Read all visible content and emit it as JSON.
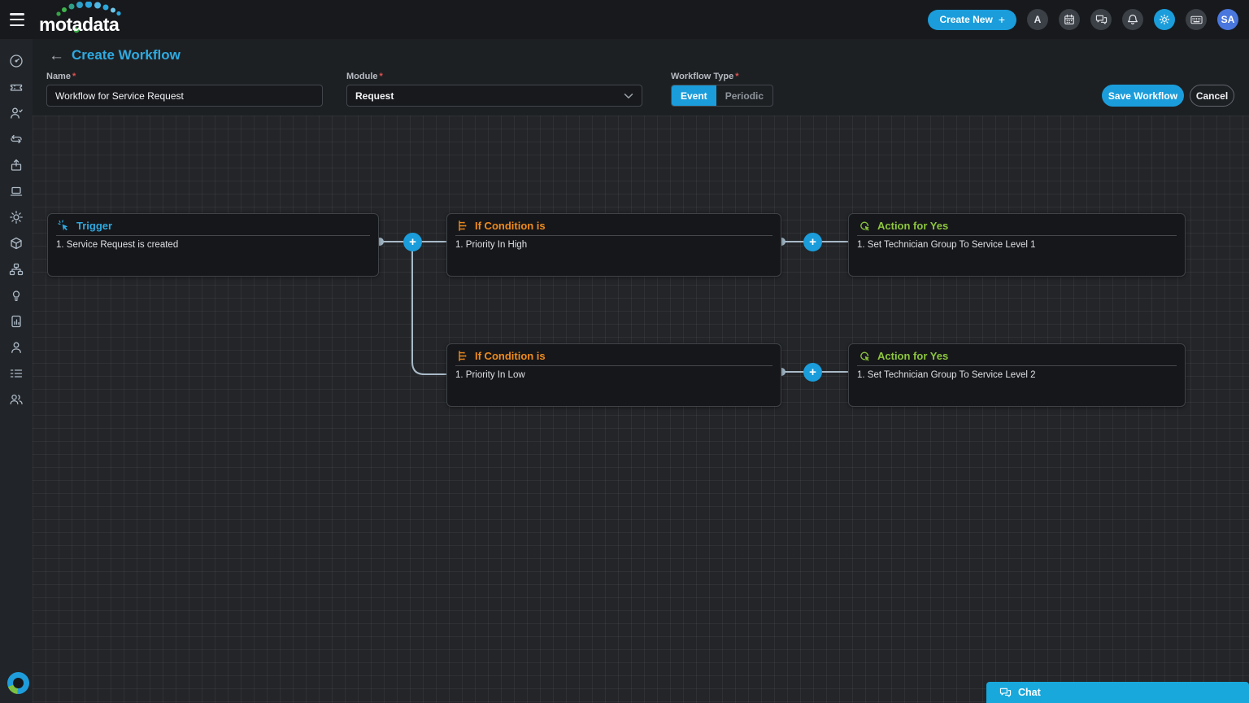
{
  "topbar": {
    "brand": "motadata",
    "create_new_label": "Create New",
    "announcement_initial": "A",
    "user_initials": "SA",
    "icon_names": [
      "hamburger-icon",
      "calendar-icon",
      "chat-bubbles-icon",
      "bell-icon",
      "gear-icon",
      "keyboard-icon"
    ]
  },
  "header": {
    "title": "Create Workflow",
    "back_arrow": "←",
    "name_label": "Name",
    "module_label": "Module",
    "workflow_type_label": "Workflow Type",
    "required_marker": "*",
    "name_value": "Workflow for Service Request",
    "module_value": "Request",
    "workflow_types": [
      "Event",
      "Periodic"
    ],
    "selected_type": "Event",
    "save_label": "Save Workflow",
    "cancel_label": "Cancel",
    "plus_glyph": "+"
  },
  "sidebar": {
    "icon_names": [
      "gauge-icon",
      "ticket-icon",
      "user-check-icon",
      "repeat-icon",
      "release-icon",
      "laptop-icon",
      "gear-icon",
      "package-icon",
      "sitemap-icon",
      "bulb-icon",
      "report-icon",
      "technician-icon",
      "task-list-icon",
      "contacts-icon"
    ]
  },
  "canvas": {
    "nodes": [
      {
        "id": "trigger",
        "type": "trigger",
        "title": "Trigger",
        "items": [
          "1. Service Request is created"
        ]
      },
      {
        "id": "condition-1",
        "type": "condition",
        "title": "If Condition is",
        "items": [
          "1. Priority In High"
        ]
      },
      {
        "id": "action-1",
        "type": "action",
        "title": "Action for Yes",
        "items": [
          "1. Set Technician Group To Service Level 1"
        ]
      },
      {
        "id": "condition-2",
        "type": "condition",
        "title": "If Condition is",
        "items": [
          "1. Priority In Low"
        ]
      },
      {
        "id": "action-2",
        "type": "action",
        "title": "Action for Yes",
        "items": [
          "1. Set Technician Group To Service Level 2"
        ]
      }
    ]
  },
  "chat": {
    "label": "Chat"
  },
  "colors": {
    "accent_blue": "#1b9ddb",
    "title_blue": "#2eaae1",
    "condition_orange": "#ef8b1d",
    "action_green": "#8dc63f",
    "canvas_bg": "#232528",
    "node_bg": "#16171a",
    "topbar_bg": "#17191c",
    "chat_bar_blue": "#18a8dc",
    "avatar_blue": "#4a77dd",
    "required_red": "#e05252"
  }
}
